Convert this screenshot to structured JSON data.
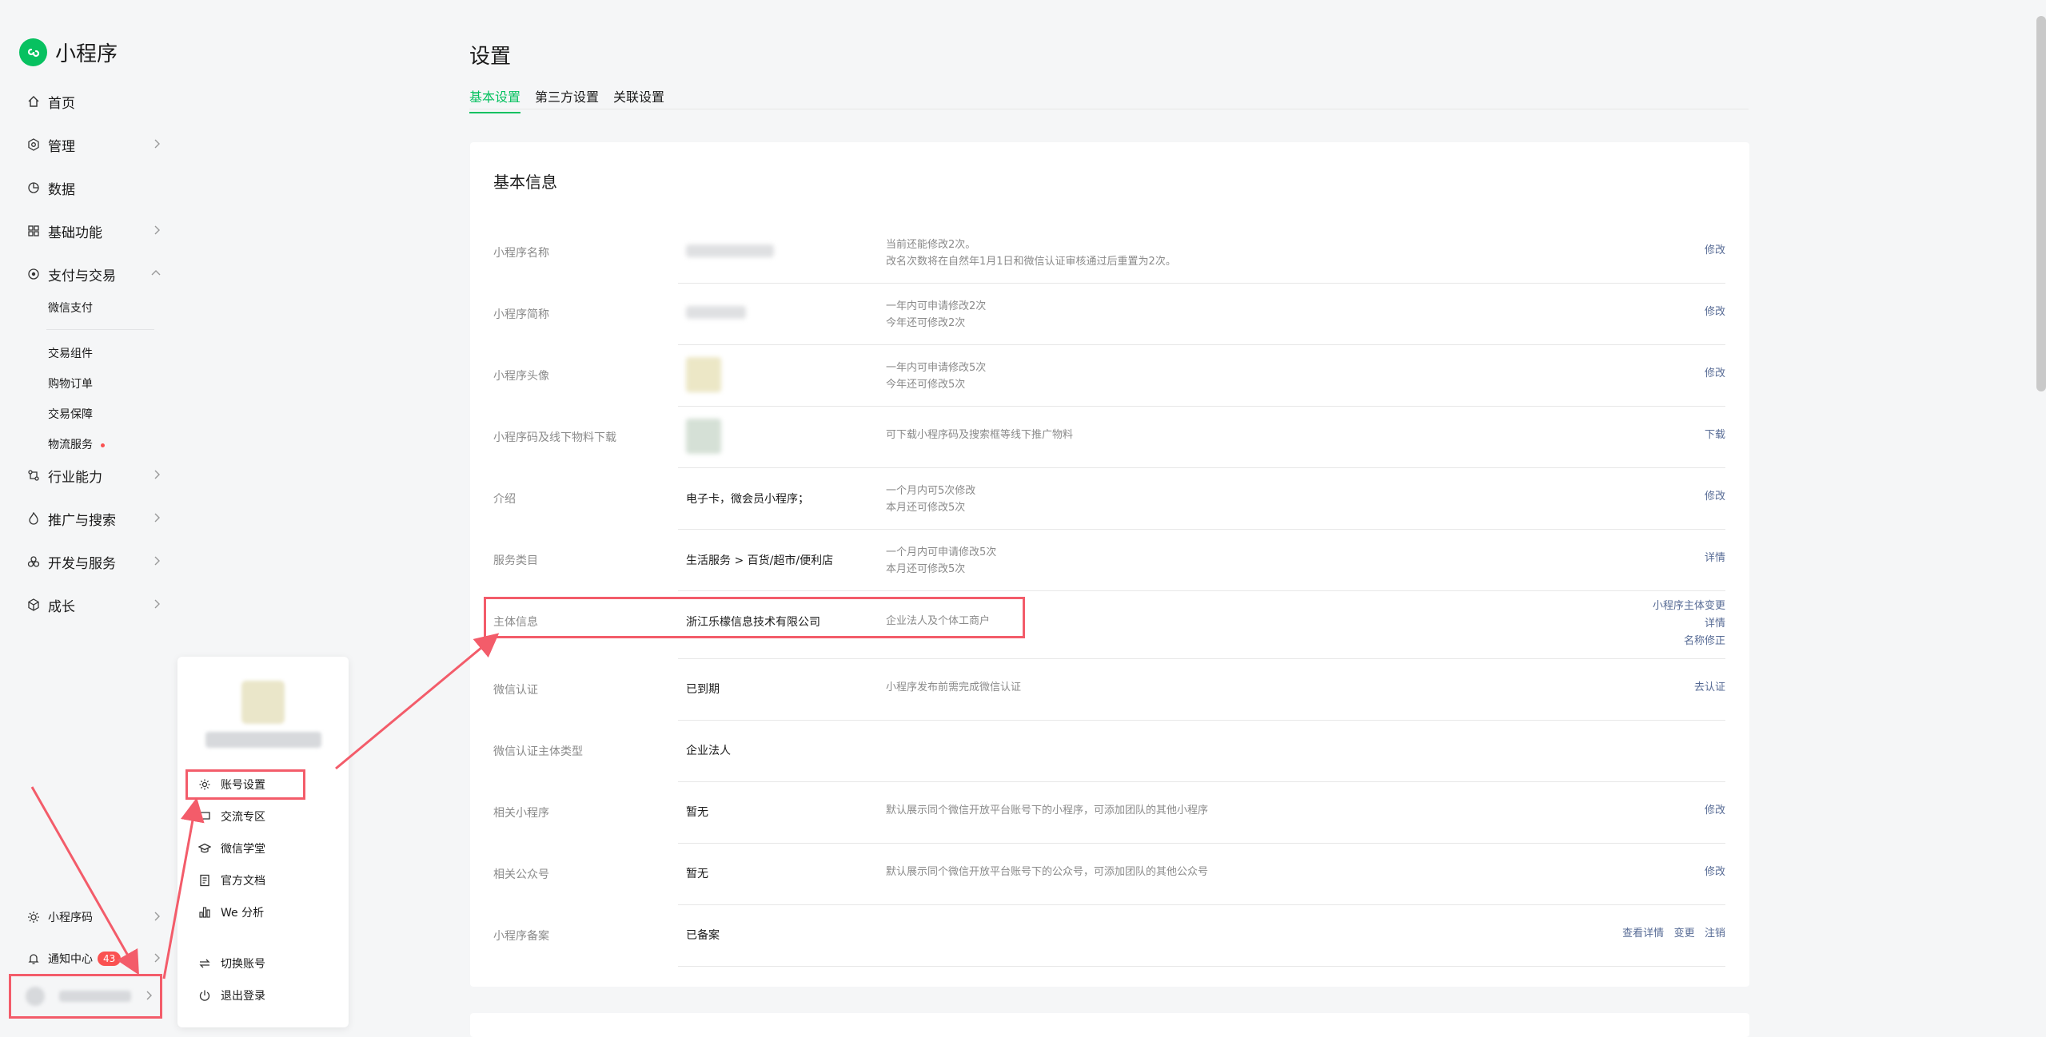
{
  "brand": {
    "name": "小程序"
  },
  "sidebar": {
    "items": [
      {
        "label": "首页",
        "icon": "home-icon"
      },
      {
        "label": "管理",
        "icon": "settings-icon"
      },
      {
        "label": "数据",
        "icon": "pie-chart-icon"
      },
      {
        "label": "基础功能",
        "icon": "grid-icon"
      },
      {
        "label": "支付与交易",
        "icon": "coin-icon"
      },
      {
        "label": "行业能力",
        "icon": "industry-icon"
      },
      {
        "label": "推广与搜索",
        "icon": "flame-icon"
      },
      {
        "label": "开发与服务",
        "icon": "dev-icon"
      },
      {
        "label": "成长",
        "icon": "cube-icon"
      }
    ],
    "pay_sub": [
      "微信支付",
      "交易组件",
      "购物订单",
      "交易保障",
      "物流服务"
    ],
    "bottom": {
      "qrcode": "小程序码",
      "notify": "通知中心",
      "notify_count": "43"
    }
  },
  "popup": {
    "items": [
      {
        "label": "账号设置",
        "icon": "gear-icon"
      },
      {
        "label": "交流专区",
        "icon": "chat-icon"
      },
      {
        "label": "微信学堂",
        "icon": "graduation-cap-icon"
      },
      {
        "label": "官方文档",
        "icon": "document-icon"
      },
      {
        "label": "We 分析",
        "icon": "bar-chart-icon"
      },
      {
        "label": "切换账号",
        "icon": "switch-icon"
      },
      {
        "label": "退出登录",
        "icon": "power-icon"
      }
    ]
  },
  "page": {
    "title": "设置",
    "tabs": [
      "基本设置",
      "第三方设置",
      "关联设置"
    ],
    "active_tab": 0
  },
  "card": {
    "title": "基本信息",
    "rows": [
      {
        "label": "小程序名称",
        "value": "",
        "desc": [
          "当前还能修改2次。",
          "改名次数将在自然年1月1日和微信认证审核通过后重置为2次。"
        ],
        "actions": [
          "修改"
        ]
      },
      {
        "label": "小程序简称",
        "value": "",
        "desc": [
          "一年内可申请修改2次",
          "今年还可修改2次"
        ],
        "actions": [
          "修改"
        ]
      },
      {
        "label": "小程序头像",
        "value": "",
        "desc": [
          "一年内可申请修改5次",
          "今年还可修改5次"
        ],
        "actions": [
          "修改"
        ]
      },
      {
        "label": "小程序码及线下物料下载",
        "value": "",
        "desc": [
          "可下载小程序码及搜索框等线下推广物料"
        ],
        "actions": [
          "下载"
        ]
      },
      {
        "label": "介绍",
        "value": "电子卡，微会员小程序；",
        "desc": [
          "一个月内可5次修改",
          "本月还可修改5次"
        ],
        "actions": [
          "修改"
        ]
      },
      {
        "label": "服务类目",
        "value": "生活服务 > 百货/超市/便利店",
        "desc": [
          "一个月内可申请修改5次",
          "本月还可修改5次"
        ],
        "actions": [
          "详情"
        ]
      },
      {
        "label": "主体信息",
        "value": "浙江乐檬信息技术有限公司",
        "desc": [
          "企业法人及个体工商户"
        ],
        "actions": [
          "小程序主体变更",
          "详情",
          "名称修正"
        ]
      },
      {
        "label": "微信认证",
        "value": "已到期",
        "desc": [
          "小程序发布前需完成微信认证"
        ],
        "actions": [
          "去认证"
        ]
      },
      {
        "label": "微信认证主体类型",
        "value": "企业法人",
        "desc": [],
        "actions": []
      },
      {
        "label": "相关小程序",
        "value": "暂无",
        "desc": [
          "默认展示同个微信开放平台账号下的小程序，可添加团队的其他小程序"
        ],
        "actions": [
          "修改"
        ]
      },
      {
        "label": "相关公众号",
        "value": "暂无",
        "desc": [
          "默认展示同个微信开放平台账号下的公众号，可添加团队的其他公众号"
        ],
        "actions": [
          "修改"
        ]
      },
      {
        "label": "小程序备案",
        "value": "已备案",
        "desc": [],
        "actions": [
          "查看详情",
          "变更",
          "注销"
        ]
      }
    ]
  },
  "colors": {
    "brand": "#07c160",
    "link": "#576b95",
    "annotation": "#f35c6a",
    "badge": "#fa5151"
  }
}
